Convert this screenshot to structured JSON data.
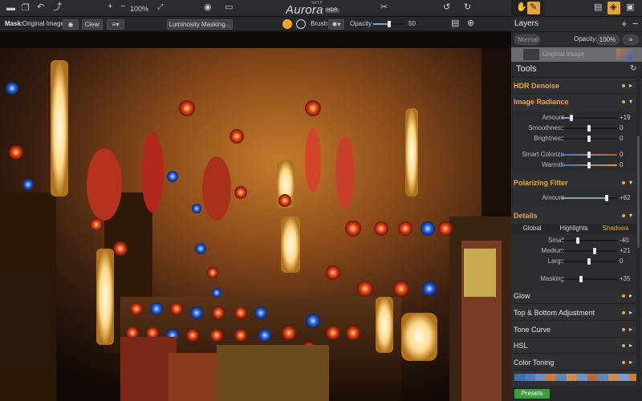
{
  "toolbar": {
    "zoom": "100%",
    "zoom_out_symbol": "−",
    "zoom_in_symbol": "+",
    "logo": "Aurora",
    "logo_small": "SKYF",
    "logo_badge": "HDR"
  },
  "subbar": {
    "mask_label": "Mask:",
    "mask_value": "Original Image",
    "clear_button": "Clear",
    "luminosity_button": "Luminosity Masking...",
    "brush_label": "Brush:",
    "opacity_label": "Opacity",
    "opacity_value": "50",
    "opacity_fraction": 0.5
  },
  "layers": {
    "title": "Layers",
    "blend_mode": "Normal",
    "opacity_label": "Opacity",
    "opacity_value": "100%",
    "layer_name": "Original Image",
    "add_symbol": "+",
    "remove_symbol": "−"
  },
  "tools": {
    "title": "Tools",
    "hdr_denoise": "HDR Denoise",
    "image_radiance": {
      "title": "Image Radiance",
      "sliders": [
        {
          "label": "Amount",
          "value": "+19",
          "fraction": 0.18
        },
        {
          "label": "Smoothness",
          "value": "0",
          "fraction": 0.5
        },
        {
          "label": "Brightness",
          "value": "0",
          "fraction": 0.5
        },
        {
          "label": "Smart Colorize",
          "value": "0",
          "fraction": 0.5
        },
        {
          "label": "Warmth",
          "value": "0",
          "fraction": 0.5
        }
      ]
    },
    "polarizing_filter": {
      "title": "Polarizing Filter",
      "sliders": [
        {
          "label": "Amount",
          "value": "+82",
          "fraction": 0.82
        }
      ]
    },
    "details": {
      "title": "Details",
      "tabs": [
        "Global",
        "Highlights",
        "Shadows"
      ],
      "active_tab": "Shadows",
      "sliders": [
        {
          "label": "Small",
          "value": "-40",
          "fraction": 0.3
        },
        {
          "label": "Medium",
          "value": "+21",
          "fraction": 0.6
        },
        {
          "label": "Large",
          "value": "0",
          "fraction": 0.5
        },
        {
          "label": "Masking",
          "value": "+35",
          "fraction": 0.35
        }
      ]
    },
    "collapsed": [
      "Glow",
      "Top & Bottom Adjustment",
      "Tone Curve",
      "HSL",
      "Color Toning"
    ],
    "presets_button": "Presets"
  },
  "colors": {
    "accent": "#f0a52a",
    "panel_bg": "#2e3033",
    "toolbar_bg": "#2a2c2f",
    "presets_green": "#3f9c3c"
  },
  "presets_swatches": [
    "#3a6fb0",
    "#4a7ec0",
    "#6b8fc2",
    "#c77d3a",
    "#5b86b8",
    "#d08c4a",
    "#6d93c6",
    "#b76a3c",
    "#5a8bbd",
    "#c98b52",
    "#7a9ac9",
    "#d07a40"
  ],
  "icons": [
    "folder-icon",
    "layers-stack-icon",
    "undo-icon",
    "redo-icon",
    "eye-icon",
    "compare-icon",
    "crop-icon",
    "plugin-icon",
    "brush-tool-icon",
    "layers-panel-icon",
    "histogram-icon",
    "image-icon"
  ]
}
